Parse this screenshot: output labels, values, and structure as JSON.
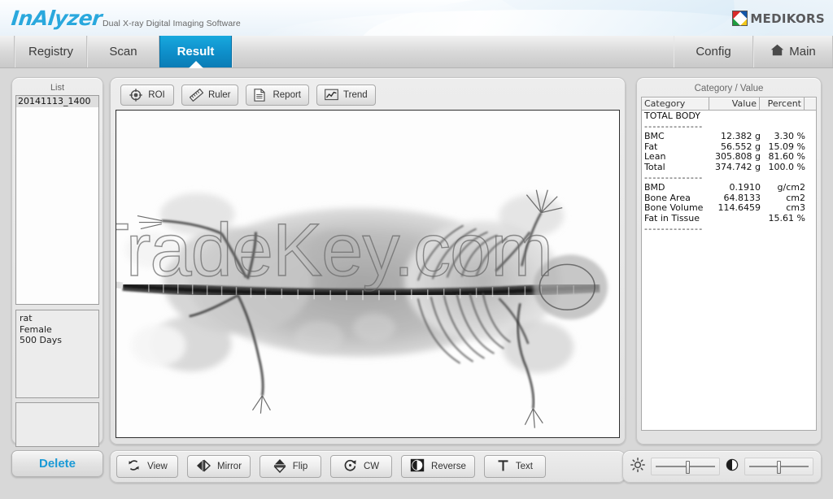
{
  "header": {
    "product_name": "InAlyzer",
    "tagline": "Dual X-ray Digital Imaging Software",
    "brand_name": "MEDIKORS",
    "brand_logo_icon": "medikors-diamond-logo"
  },
  "tabs": {
    "left": [
      {
        "label": "Registry",
        "active": false
      },
      {
        "label": "Scan",
        "active": false
      },
      {
        "label": "Result",
        "active": true
      }
    ],
    "right": [
      {
        "label": "Config",
        "icon": ""
      },
      {
        "label": "Main",
        "icon": "home-icon"
      }
    ]
  },
  "sidebar": {
    "title": "List",
    "items": [
      "20141113_1400"
    ],
    "subject": {
      "species": "rat",
      "sex": "Female",
      "age": "500 Days"
    },
    "delete_label": "Delete"
  },
  "image_toolbar": [
    {
      "label": "ROI",
      "icon": "crosshair-target-icon"
    },
    {
      "label": "Ruler",
      "icon": "ruler-icon"
    },
    {
      "label": "Report",
      "icon": "document-icon"
    },
    {
      "label": "Trend",
      "icon": "line-chart-icon"
    }
  ],
  "image_view": {
    "watermark": "TradeKey.com",
    "alt": "dual-energy x-ray scan of a laboratory rat, dorsal view"
  },
  "results": {
    "title": "Category / Value",
    "columns": [
      "Category",
      "Value",
      "Percent"
    ],
    "section_label": "TOTAL BODY",
    "divider": "--------------",
    "group1": [
      {
        "label": "BMC",
        "value": "12.382 g",
        "percent": "3.30 %"
      },
      {
        "label": "Fat",
        "value": "56.552 g",
        "percent": "15.09 %"
      },
      {
        "label": "Lean",
        "value": "305.808 g",
        "percent": "81.60 %"
      },
      {
        "label": "Total",
        "value": "374.742 g",
        "percent": "100.0 %"
      }
    ],
    "group2": [
      {
        "label": "BMD",
        "value": "0.1910",
        "percent": "g/cm2"
      },
      {
        "label": "Bone Area",
        "value": "64.8133",
        "percent": "cm2"
      },
      {
        "label": "Bone Volume",
        "value": "114.6459",
        "percent": "cm3"
      },
      {
        "label": "Fat in Tissue",
        "value": "",
        "percent": "15.61 %"
      }
    ]
  },
  "bottom_toolbar": [
    {
      "label": "View",
      "icon": "refresh-cycle-icon"
    },
    {
      "label": "Mirror",
      "icon": "mirror-horizontal-icon"
    },
    {
      "label": "Flip",
      "icon": "flip-vertical-icon"
    },
    {
      "label": "CW",
      "icon": "rotate-clockwise-icon"
    },
    {
      "label": "Reverse",
      "icon": "invert-contrast-icon"
    },
    {
      "label": "Text",
      "icon": "text-tool-icon"
    }
  ],
  "adjustments": {
    "brightness": {
      "icon": "brightness-sun-icon",
      "position_percent": 55
    },
    "contrast": {
      "icon": "contrast-halfcircle-icon",
      "position_percent": 50
    }
  },
  "colors": {
    "accent": "#0e8ec9",
    "logo": "#2aa8dd",
    "panel_bg": "#e7e7e7",
    "chrome": "#d8d8d8"
  }
}
